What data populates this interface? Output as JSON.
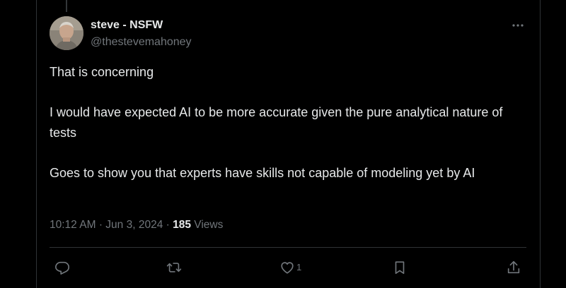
{
  "author": {
    "display_name": "steve - NSFW",
    "handle": "@thestevemahoney"
  },
  "tweet": {
    "paragraphs": [
      "That is concerning",
      "I would have expected AI to be more accurate given the pure analytical nature of tests",
      "Goes to show you that experts have skills not capable of modeling yet by AI"
    ],
    "time": "10:12 AM",
    "separator": "·",
    "date": "Jun 3, 2024",
    "views_count": "185",
    "views_label": "Views"
  },
  "actions": {
    "reply_icon": "reply-icon",
    "repost_icon": "repost-icon",
    "like_icon": "heart-icon",
    "like_count": "1",
    "bookmark_icon": "bookmark-icon",
    "share_icon": "share-icon",
    "more_icon": "more-icon"
  },
  "colors": {
    "background": "#000000",
    "text_primary": "#e7e9ea",
    "text_secondary": "#71767b",
    "border": "#2f3336"
  }
}
